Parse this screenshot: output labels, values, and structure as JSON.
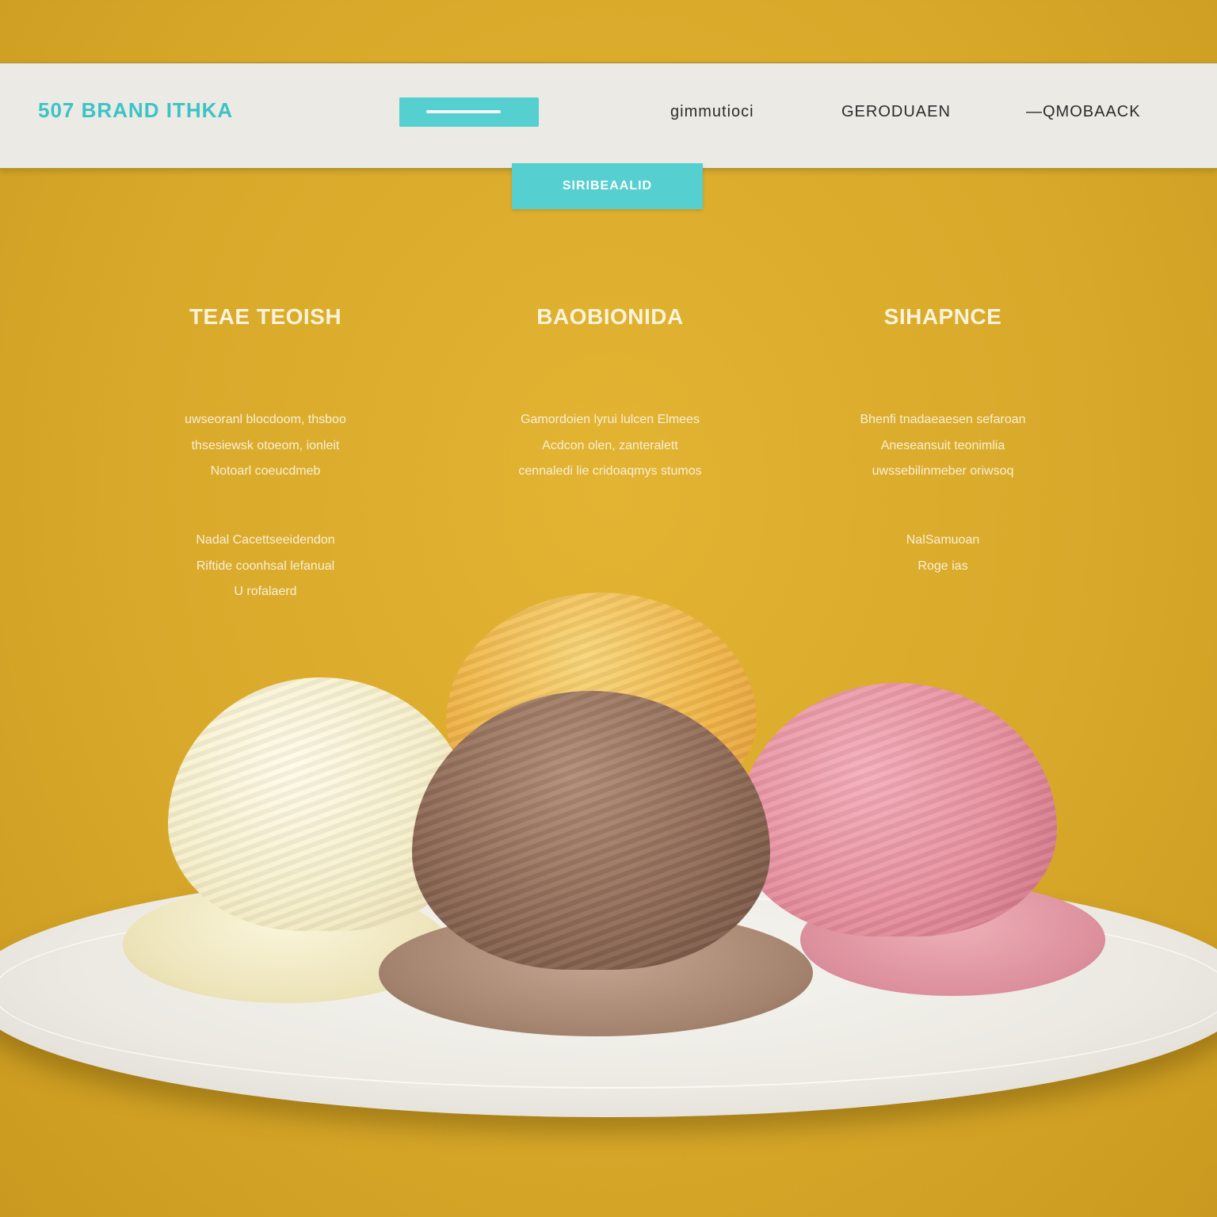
{
  "navbar": {
    "logo": "507 BRAND ITHKA",
    "search_label": "",
    "links": [
      "gimmutioci",
      "GERODUAEN",
      "—QMOBAACK"
    ]
  },
  "cta": {
    "label": "SIRIBEAALID"
  },
  "features": [
    {
      "title": "TEAE TEOISH",
      "body": [
        "uwseoranl blocdoom, thsboo",
        "thsesiewsk otoeom, ionleit",
        "Notoarl coeucdmeb"
      ],
      "note": [
        "Nadal Cacettseeidendon",
        "Riftide coonhsal lefanual",
        "U rofalaerd"
      ]
    },
    {
      "title": "BAOBIONIDA",
      "body": [
        "Gamordoien lyrui lulcen Elmees",
        "Acdcon olen, zanteralett",
        "cennaledi lie cridoaqmys stumos"
      ],
      "note": []
    },
    {
      "title": "SIHAPNCE",
      "body": [
        "Bhenfi tnadaeaesen sefaroan",
        "Aneseansuit teonimlia",
        "uwssebilinmeber oriwsoq"
      ],
      "note": [
        "NalSamuoan",
        "Roge ias"
      ]
    }
  ],
  "colors": {
    "background": "#d8a92a",
    "accent": "#55cfcf",
    "navbar": "#eceae4"
  }
}
